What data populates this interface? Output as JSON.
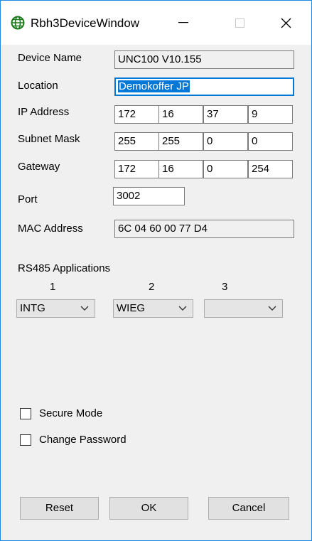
{
  "window": {
    "title": "Rbh3DeviceWindow"
  },
  "form": {
    "device_name": {
      "label": "Device Name",
      "value": "UNC100 V10.155"
    },
    "location": {
      "label": "Location",
      "value": "Demokoffer JP"
    },
    "ip_address": {
      "label": "IP Address",
      "octets": [
        "172",
        "16",
        "37",
        "9"
      ]
    },
    "subnet_mask": {
      "label": "Subnet Mask",
      "octets": [
        "255",
        "255",
        "0",
        "0"
      ]
    },
    "gateway": {
      "label": "Gateway",
      "octets": [
        "172",
        "16",
        "0",
        "254"
      ]
    },
    "port": {
      "label": "Port",
      "value": "3002"
    },
    "mac_address": {
      "label": "MAC Address",
      "value": "6C 04 60 00 77 D4"
    }
  },
  "rs485": {
    "label": "RS485 Applications",
    "channels": [
      {
        "number": "1",
        "value": "INTG"
      },
      {
        "number": "2",
        "value": "WIEG"
      },
      {
        "number": "3",
        "value": ""
      }
    ]
  },
  "options": {
    "secure_mode": {
      "label": "Secure Mode",
      "checked": false
    },
    "change_password": {
      "label": "Change Password",
      "checked": false
    }
  },
  "buttons": {
    "reset": "Reset",
    "ok": "OK",
    "cancel": "Cancel"
  },
  "icons": {
    "app": "globe-icon",
    "minimize": "minimize-icon",
    "maximize": "maximize-icon",
    "close": "close-icon",
    "dropdown": "chevron-down-icon"
  }
}
